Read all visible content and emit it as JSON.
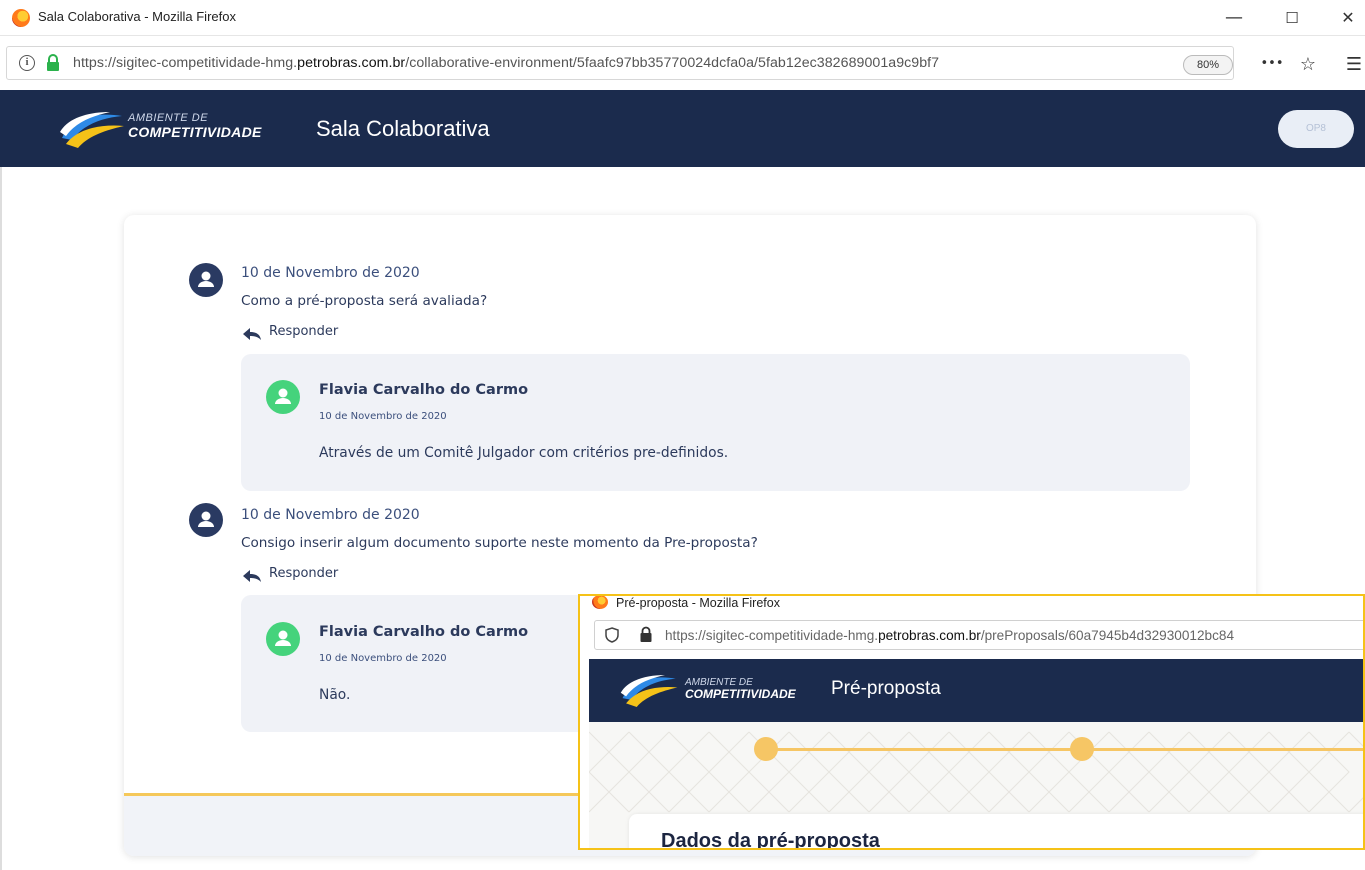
{
  "window": {
    "title": "Sala Colaborativa - Mozilla Firefox",
    "minimize": "—",
    "maximize": "☐",
    "close": "✕"
  },
  "urlbar": {
    "url_prefix": "https://sigitec-competitividade-hmg.",
    "url_domain": "petrobras.com.br",
    "url_path": "/collaborative-environment/5faafc97bb35770024dcfa0a/5fab12ec382689001a9c9bf7",
    "zoom": "80%",
    "more": "•••",
    "bookmark": "☆",
    "menu": "☰"
  },
  "header": {
    "brand_small": "AMBIENTE DE",
    "brand_big": "COMPETITIVIDADE",
    "title": "Sala Colaborativa",
    "user_badge": "OP8"
  },
  "threads": [
    {
      "date": "10 de Novembro de 2020",
      "question": "Como a pré-proposta será avaliada?",
      "reply_label": "Responder",
      "answer": {
        "author": "Flavia Carvalho do Carmo",
        "date": "10 de Novembro de 2020",
        "text": "Através de um Comitê Julgador com critérios pre-definidos."
      }
    },
    {
      "date": "10 de Novembro de 2020",
      "question": "Consigo inserir algum documento suporte neste momento da Pre-proposta?",
      "reply_label": "Responder",
      "answer": {
        "author": "Flavia Carvalho do Carmo",
        "date": "10 de Novembro de 2020",
        "text": "Não."
      }
    }
  ],
  "overlay": {
    "window_title": "Pré-proposta - Mozilla Firefox",
    "url_prefix": "https://sigitec-competitividade-hmg.",
    "url_domain": "petrobras.com.br",
    "url_path": "/preProposals/60a7945b4d32930012bc84",
    "brand_small": "AMBIENTE DE",
    "brand_big": "COMPETITIVIDADE",
    "page_title": "Pré-proposta",
    "section_title": "Dados da pré-proposta"
  },
  "colors": {
    "header_bg": "#1b2b4d",
    "accent_yellow": "#f5c85a",
    "answer_bg": "#f0f2f7",
    "answer_avatar": "#45d37c",
    "question_avatar": "#2a3a62"
  }
}
